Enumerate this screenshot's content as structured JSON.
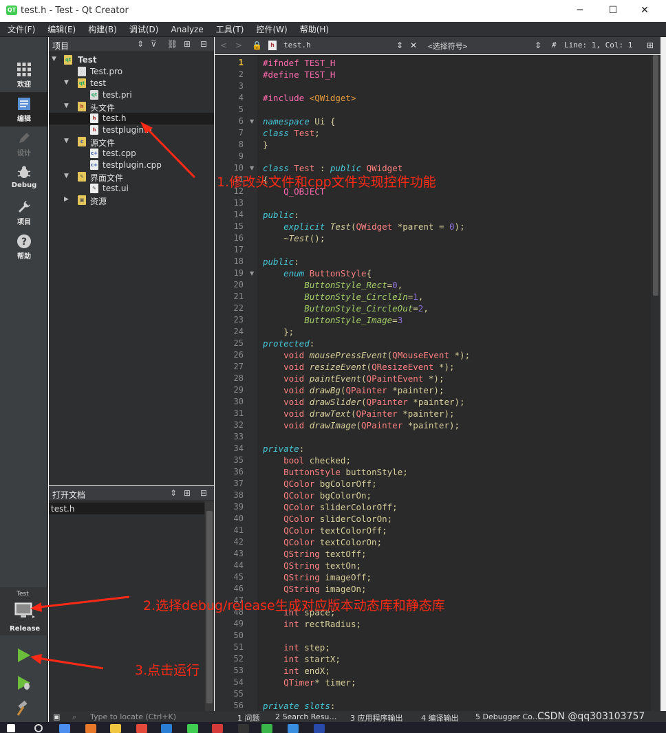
{
  "window": {
    "title": "test.h - Test - Qt Creator",
    "app_icon": "QT",
    "minimize": "─",
    "maximize": "☐",
    "close": "✕"
  },
  "menu": [
    "文件(F)",
    "编辑(E)",
    "构建(B)",
    "调试(D)",
    "Analyze",
    "工具(T)",
    "控件(W)",
    "帮助(H)"
  ],
  "modes": [
    {
      "name": "welcome",
      "label": "欢迎"
    },
    {
      "name": "edit",
      "label": "编辑"
    },
    {
      "name": "design",
      "label": "设计"
    },
    {
      "name": "debug",
      "label": "Debug"
    },
    {
      "name": "project",
      "label": "项目"
    },
    {
      "name": "help",
      "label": "帮助"
    }
  ],
  "kit": {
    "project": "Test",
    "config": "Release"
  },
  "project_panel": {
    "title": "项目"
  },
  "tree": [
    {
      "label": "Test",
      "icon": "qt-project-icon"
    },
    {
      "label": "Test.pro",
      "icon": "pro-file-icon"
    },
    {
      "label": "test",
      "icon": "qt-project-icon"
    },
    {
      "label": "test.pri",
      "icon": "pri-file-icon"
    },
    {
      "label": "头文件",
      "icon": "header-folder-icon"
    },
    {
      "label": "test.h",
      "icon": "header-file-icon"
    },
    {
      "label": "testplugin.h",
      "icon": "header-file-icon"
    },
    {
      "label": "源文件",
      "icon": "source-folder-icon"
    },
    {
      "label": "test.cpp",
      "icon": "cpp-file-icon"
    },
    {
      "label": "testplugin.cpp",
      "icon": "cpp-file-icon"
    },
    {
      "label": "界面文件",
      "icon": "form-folder-icon"
    },
    {
      "label": "test.ui",
      "icon": "ui-file-icon"
    },
    {
      "label": "资源",
      "icon": "resource-folder-icon"
    }
  ],
  "open_docs": {
    "title": "打开文档",
    "items": [
      "test.h"
    ]
  },
  "editor": {
    "file": "test.h",
    "symbol": "<选择符号>",
    "hash": "#",
    "position": "Line: 1, Col: 1"
  },
  "code": [
    "#ifndef TEST_H",
    "#define TEST_H",
    "",
    "#include <QWidget>",
    "",
    "namespace Ui {",
    "class Test;",
    "}",
    "",
    "class Test : public QWidget",
    "{",
    "    Q_OBJECT",
    "",
    "public:",
    "    explicit Test(QWidget *parent = 0);",
    "    ~Test();",
    "",
    "public:",
    "    enum ButtonStyle{",
    "        ButtonStyle_Rect=0,",
    "        ButtonStyle_CircleIn=1,",
    "        ButtonStyle_CircleOut=2,",
    "        ButtonStyle_Image=3",
    "    };",
    "protected:",
    "    void mousePressEvent(QMouseEvent *);",
    "    void resizeEvent(QResizeEvent *);",
    "    void paintEvent(QPaintEvent *);",
    "    void drawBg(QPainter *painter);",
    "    void drawSlider(QPainter *painter);",
    "    void drawText(QPainter *painter);",
    "    void drawImage(QPainter *painter);",
    "",
    "private:",
    "    bool checked;",
    "    ButtonStyle buttonStyle;",
    "    QColor bgColorOff;",
    "    QColor bgColorOn;",
    "    QColor sliderColorOff;",
    "    QColor sliderColorOn;",
    "    QColor textColorOff;",
    "    QColor textColorOn;",
    "    QString textOff;",
    "    QString textOn;",
    "    QString imageOff;",
    "    QString imageOn;",
    "    ",
    "    int space;",
    "    int rectRadius;",
    "",
    "    int step;",
    "    int startX;",
    "    int endX;",
    "    QTimer* timer;",
    "",
    "private slots:"
  ],
  "status": {
    "locate_placeholder": "Type to locate (Ctrl+K)",
    "tabs": [
      "1 问题",
      "2 Search Resu…",
      "3 应用程序输出",
      "4 编译输出",
      "5 Debugger Co…"
    ],
    "watermark": "CSDN @qq303103757"
  },
  "annotations": [
    "1.修改头文件和cpp文件实现控件功能",
    "2.选择debug/release生成对应版本动态库和静态库",
    "3.点击运行"
  ],
  "colors": {
    "annotation": "#ff2a16",
    "accent_run": "#6dbd3c"
  }
}
